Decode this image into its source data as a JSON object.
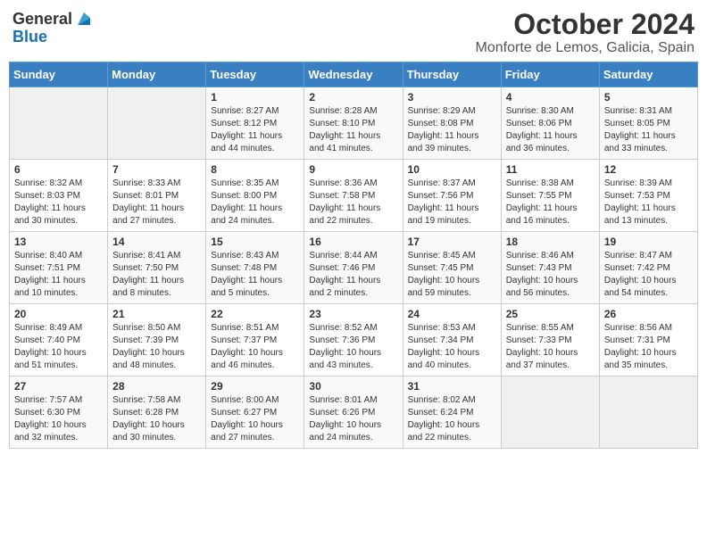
{
  "header": {
    "logo_general": "General",
    "logo_blue": "Blue",
    "month": "October 2024",
    "location": "Monforte de Lemos, Galicia, Spain"
  },
  "weekdays": [
    "Sunday",
    "Monday",
    "Tuesday",
    "Wednesday",
    "Thursday",
    "Friday",
    "Saturday"
  ],
  "weeks": [
    [
      {
        "day": "",
        "info": ""
      },
      {
        "day": "",
        "info": ""
      },
      {
        "day": "1",
        "info": "Sunrise: 8:27 AM\nSunset: 8:12 PM\nDaylight: 11 hours and 44 minutes."
      },
      {
        "day": "2",
        "info": "Sunrise: 8:28 AM\nSunset: 8:10 PM\nDaylight: 11 hours and 41 minutes."
      },
      {
        "day": "3",
        "info": "Sunrise: 8:29 AM\nSunset: 8:08 PM\nDaylight: 11 hours and 39 minutes."
      },
      {
        "day": "4",
        "info": "Sunrise: 8:30 AM\nSunset: 8:06 PM\nDaylight: 11 hours and 36 minutes."
      },
      {
        "day": "5",
        "info": "Sunrise: 8:31 AM\nSunset: 8:05 PM\nDaylight: 11 hours and 33 minutes."
      }
    ],
    [
      {
        "day": "6",
        "info": "Sunrise: 8:32 AM\nSunset: 8:03 PM\nDaylight: 11 hours and 30 minutes."
      },
      {
        "day": "7",
        "info": "Sunrise: 8:33 AM\nSunset: 8:01 PM\nDaylight: 11 hours and 27 minutes."
      },
      {
        "day": "8",
        "info": "Sunrise: 8:35 AM\nSunset: 8:00 PM\nDaylight: 11 hours and 24 minutes."
      },
      {
        "day": "9",
        "info": "Sunrise: 8:36 AM\nSunset: 7:58 PM\nDaylight: 11 hours and 22 minutes."
      },
      {
        "day": "10",
        "info": "Sunrise: 8:37 AM\nSunset: 7:56 PM\nDaylight: 11 hours and 19 minutes."
      },
      {
        "day": "11",
        "info": "Sunrise: 8:38 AM\nSunset: 7:55 PM\nDaylight: 11 hours and 16 minutes."
      },
      {
        "day": "12",
        "info": "Sunrise: 8:39 AM\nSunset: 7:53 PM\nDaylight: 11 hours and 13 minutes."
      }
    ],
    [
      {
        "day": "13",
        "info": "Sunrise: 8:40 AM\nSunset: 7:51 PM\nDaylight: 11 hours and 10 minutes."
      },
      {
        "day": "14",
        "info": "Sunrise: 8:41 AM\nSunset: 7:50 PM\nDaylight: 11 hours and 8 minutes."
      },
      {
        "day": "15",
        "info": "Sunrise: 8:43 AM\nSunset: 7:48 PM\nDaylight: 11 hours and 5 minutes."
      },
      {
        "day": "16",
        "info": "Sunrise: 8:44 AM\nSunset: 7:46 PM\nDaylight: 11 hours and 2 minutes."
      },
      {
        "day": "17",
        "info": "Sunrise: 8:45 AM\nSunset: 7:45 PM\nDaylight: 10 hours and 59 minutes."
      },
      {
        "day": "18",
        "info": "Sunrise: 8:46 AM\nSunset: 7:43 PM\nDaylight: 10 hours and 56 minutes."
      },
      {
        "day": "19",
        "info": "Sunrise: 8:47 AM\nSunset: 7:42 PM\nDaylight: 10 hours and 54 minutes."
      }
    ],
    [
      {
        "day": "20",
        "info": "Sunrise: 8:49 AM\nSunset: 7:40 PM\nDaylight: 10 hours and 51 minutes."
      },
      {
        "day": "21",
        "info": "Sunrise: 8:50 AM\nSunset: 7:39 PM\nDaylight: 10 hours and 48 minutes."
      },
      {
        "day": "22",
        "info": "Sunrise: 8:51 AM\nSunset: 7:37 PM\nDaylight: 10 hours and 46 minutes."
      },
      {
        "day": "23",
        "info": "Sunrise: 8:52 AM\nSunset: 7:36 PM\nDaylight: 10 hours and 43 minutes."
      },
      {
        "day": "24",
        "info": "Sunrise: 8:53 AM\nSunset: 7:34 PM\nDaylight: 10 hours and 40 minutes."
      },
      {
        "day": "25",
        "info": "Sunrise: 8:55 AM\nSunset: 7:33 PM\nDaylight: 10 hours and 37 minutes."
      },
      {
        "day": "26",
        "info": "Sunrise: 8:56 AM\nSunset: 7:31 PM\nDaylight: 10 hours and 35 minutes."
      }
    ],
    [
      {
        "day": "27",
        "info": "Sunrise: 7:57 AM\nSunset: 6:30 PM\nDaylight: 10 hours and 32 minutes."
      },
      {
        "day": "28",
        "info": "Sunrise: 7:58 AM\nSunset: 6:28 PM\nDaylight: 10 hours and 30 minutes."
      },
      {
        "day": "29",
        "info": "Sunrise: 8:00 AM\nSunset: 6:27 PM\nDaylight: 10 hours and 27 minutes."
      },
      {
        "day": "30",
        "info": "Sunrise: 8:01 AM\nSunset: 6:26 PM\nDaylight: 10 hours and 24 minutes."
      },
      {
        "day": "31",
        "info": "Sunrise: 8:02 AM\nSunset: 6:24 PM\nDaylight: 10 hours and 22 minutes."
      },
      {
        "day": "",
        "info": ""
      },
      {
        "day": "",
        "info": ""
      }
    ]
  ]
}
